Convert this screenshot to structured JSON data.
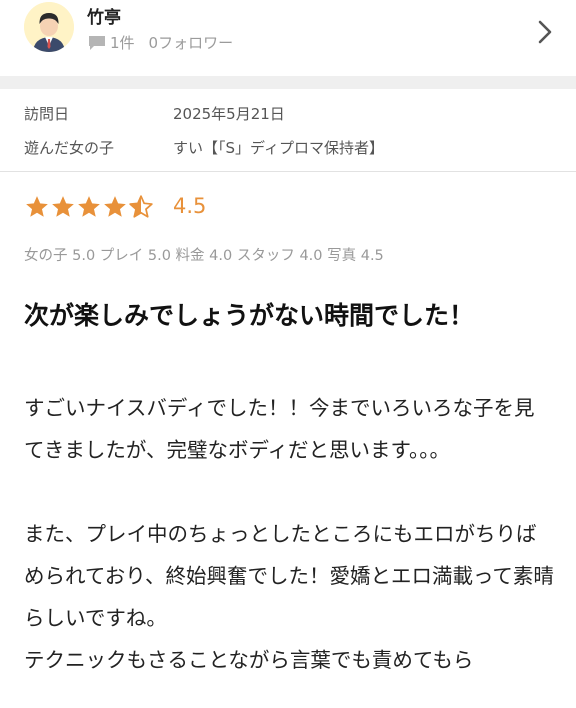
{
  "user": {
    "name": "竹亭",
    "review_count": "1件",
    "follower_count": "0フォロワー",
    "avatar_icon": "user-avatar-icon",
    "comment_icon": "comment-icon",
    "chevron_icon": "chevron-right-icon"
  },
  "info": [
    {
      "label": "訪問日",
      "value": "2025年5月21日"
    },
    {
      "label": "遊んだ女の子",
      "value": "すい【「S」ディプロマ保持者】"
    }
  ],
  "rating": {
    "score": "4.5",
    "stars": 4.5,
    "star_color": "#e8913a",
    "subscores": "女の子 5.0 プレイ 5.0 料金 4.0 スタッフ 4.0 写真 4.5"
  },
  "review": {
    "title": "次が楽しみでしょうがない時間でした！",
    "paragraphs": [
      "すごいナイスバディでした！！今までいろいろな子を見てきましたが、完璧なボディだと思います。。。",
      "",
      "また、プレイ中のちょっとしたところにもエロがちりばめられており、終始興奮でした！愛嬌とエロ満載って素晴らしいですね。",
      "テクニックもさることながら言葉でも責めてもら"
    ]
  }
}
